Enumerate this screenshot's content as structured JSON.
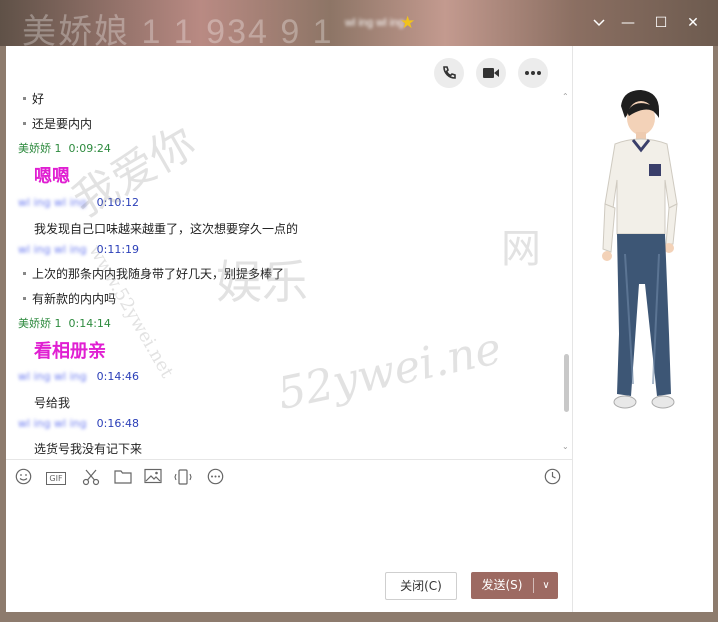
{
  "window": {
    "title_background_text": "美娇娘 1 1 934 9 1",
    "contact_name": "wl ing wl ing",
    "minimize_label": "—",
    "maximize_label": "☐",
    "close_label": "✕"
  },
  "header_actions": [
    {
      "name": "voice-call",
      "icon": "phone-icon"
    },
    {
      "name": "video-call",
      "icon": "video-icon"
    },
    {
      "name": "more",
      "icon": "more-icon"
    }
  ],
  "messages": {
    "m1": "好",
    "m2": "还是要内内",
    "h1_name": "美娇娇 1",
    "h1_time": "0:09:24",
    "m3": "嗯嗯",
    "h2_name": "wl ing wl ing",
    "h2_time": "0:10:12",
    "m4": "我发现自己口味越来越重了，这次想要穿久一点的",
    "h3_name": "wl ing wl ing",
    "h3_time": "0:11:19",
    "m5": "上次的那条内内我随身带了好几天，别提多棒了",
    "m6": "有新款的内内吗",
    "h4_name": "美娇娇 1",
    "h4_time": "0:14:14",
    "m7": "看相册亲",
    "h5_name": "wl ing wl ing",
    "h5_time": "0:14:46",
    "m8": "号给我",
    "h6_name": "wl ing wl ing",
    "h6_time": "0:16:48",
    "m9": "选货号我没有记下来"
  },
  "toolbar": {
    "emoji_icon": "emoji-icon",
    "gif_label": "GIF",
    "scissors_icon": "screenshot-icon",
    "folder_icon": "folder-icon",
    "image_icon": "image-icon",
    "shake_icon": "shake-icon",
    "more_icon": "more-icon",
    "history_icon": "history-icon"
  },
  "buttons": {
    "close_label": "关闭(C)",
    "send_label": "发送(S)",
    "send_arrow": "∨"
  },
  "watermark": {
    "line1": "www.52ywei.net",
    "line2": "我爱你",
    "line3": "娱乐",
    "line4": "网",
    "line5": "52ywei.ne"
  }
}
